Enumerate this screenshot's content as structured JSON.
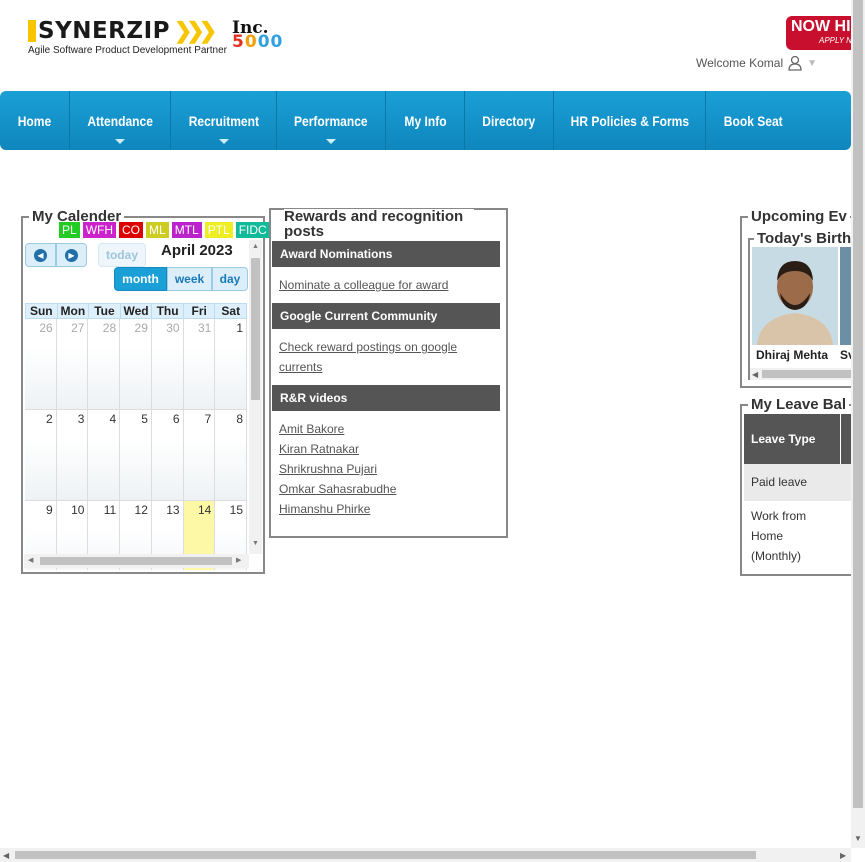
{
  "header": {
    "brand": "SYNERZIP",
    "tagline": "Agile Software Product Development Partner",
    "inc_word": "Inc.",
    "inc_number": [
      "5",
      "0",
      "00"
    ],
    "hiring_line1": "NOW HI",
    "hiring_line2": "APPLY N",
    "welcome": "Welcome Komal"
  },
  "nav": [
    {
      "label": "Home",
      "dropdown": false
    },
    {
      "label": "Attendance",
      "dropdown": true
    },
    {
      "label": "Recruitment",
      "dropdown": true
    },
    {
      "label": "Performance",
      "dropdown": true
    },
    {
      "label": "My Info",
      "dropdown": false
    },
    {
      "label": "Directory",
      "dropdown": false
    },
    {
      "label": "HR Policies & Forms",
      "dropdown": false
    },
    {
      "label": "Book Seat",
      "dropdown": false
    }
  ],
  "calendar": {
    "title": "My Calender",
    "month": "April 2023",
    "today_label": "today",
    "views": [
      "month",
      "week",
      "day"
    ],
    "active_view": "month",
    "legend": [
      {
        "label": "PL",
        "color": "#22cc22"
      },
      {
        "label": "WFH",
        "color": "#cc22cc"
      },
      {
        "label": "CO",
        "color": "#dd0000"
      },
      {
        "label": "ML",
        "color": "#cccc22"
      },
      {
        "label": "MTL",
        "color": "#bb22cc"
      },
      {
        "label": "PTL",
        "color": "#eeee22"
      },
      {
        "label": "FIDC",
        "color": "#11bb99"
      }
    ],
    "weekdays": [
      "Sun",
      "Mon",
      "Tue",
      "Wed",
      "Thu",
      "Fri",
      "Sat"
    ],
    "weeks": [
      [
        "26",
        "27",
        "28",
        "29",
        "30",
        "31",
        "1"
      ],
      [
        "2",
        "3",
        "4",
        "5",
        "6",
        "7",
        "8"
      ],
      [
        "9",
        "10",
        "11",
        "12",
        "13",
        "14",
        "15"
      ]
    ],
    "today_day": "14"
  },
  "rewards": {
    "title": "Rewards and recognition posts",
    "sections": [
      {
        "heading": "Award Nominations",
        "links": [
          "Nominate a colleague for award"
        ]
      },
      {
        "heading": "Google Current Community",
        "links": [
          "Check reward postings on google currents"
        ]
      },
      {
        "heading": "R&R videos",
        "links": [
          "Amit Bakore",
          "Kiran Ratnakar",
          "Shrikrushna Pujari",
          "Omkar Sahasrabudhe",
          "Himanshu Phirke"
        ]
      }
    ]
  },
  "upcoming": {
    "title": "Upcoming Ev",
    "birthdays_title": "Today's Birth",
    "people": [
      "Dhiraj Mehta",
      "Sv"
    ]
  },
  "leave": {
    "title": "My Leave Bal",
    "header": "Leave Type",
    "rows": [
      "Paid leave",
      "Work from Home (Monthly)"
    ]
  }
}
